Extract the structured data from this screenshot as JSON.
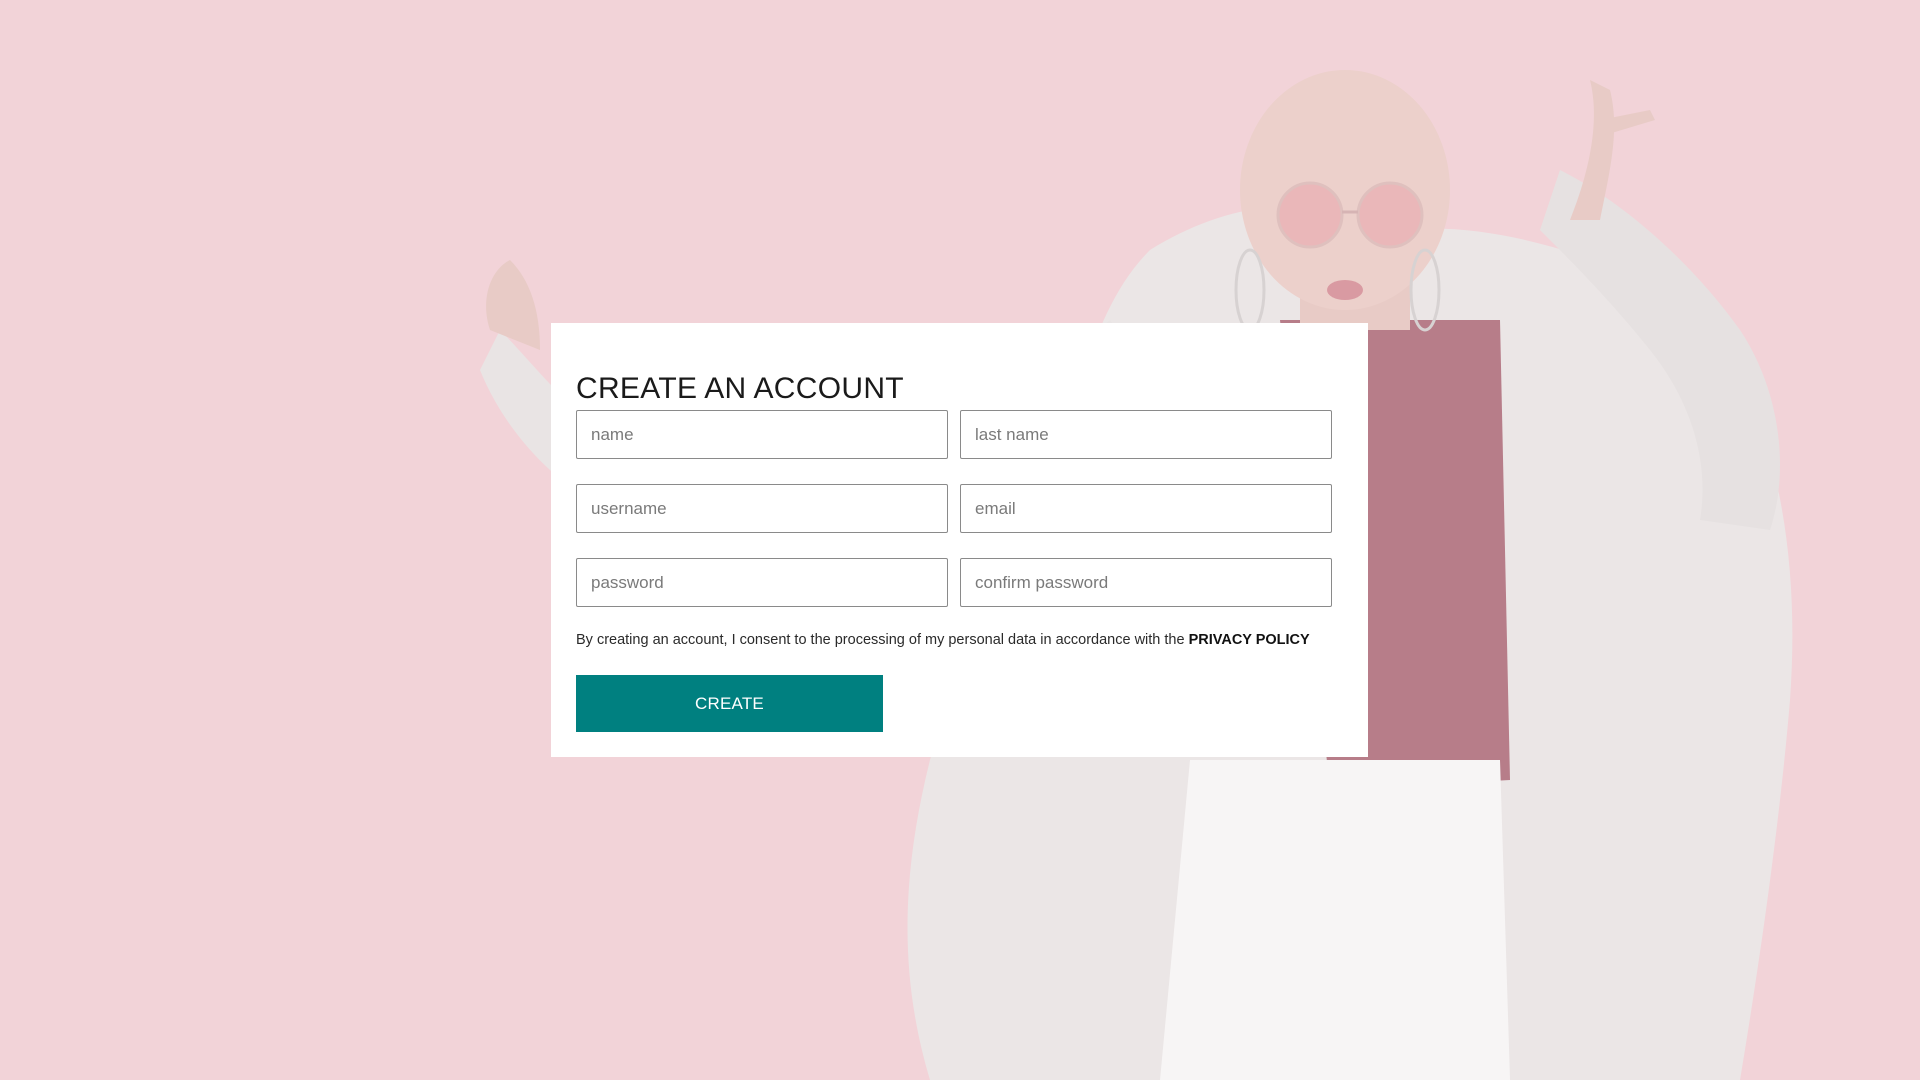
{
  "form": {
    "title": "CREATE AN ACCOUNT",
    "fields": {
      "name_placeholder": "name",
      "last_name_placeholder": "last name",
      "username_placeholder": "username",
      "email_placeholder": "email",
      "password_placeholder": "password",
      "confirm_password_placeholder": "confirm password"
    },
    "consent_text": "By creating an account, I consent to the processing of my personal data in accordance with the ",
    "privacy_policy_link": "PRIVACY POLICY",
    "submit_label": "CREATE"
  },
  "colors": {
    "background": "#f2d3d8",
    "card": "#ffffff",
    "button": "#008080",
    "button_text": "#ffffff"
  }
}
